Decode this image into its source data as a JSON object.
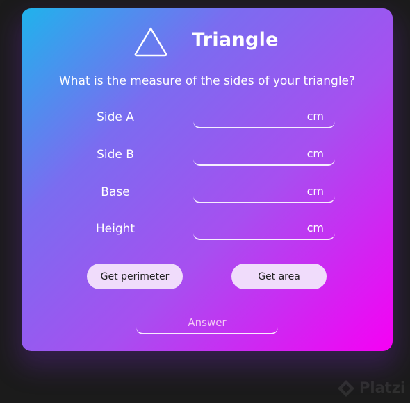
{
  "card": {
    "title": "Triangle",
    "title_icon": "triangle-outline-icon",
    "question": "What is the measure of the sides of your triangle?"
  },
  "fields": [
    {
      "label": "Side A",
      "unit": "cm",
      "value": ""
    },
    {
      "label": "Side B",
      "unit": "cm",
      "value": ""
    },
    {
      "label": "Base",
      "unit": "cm",
      "value": ""
    },
    {
      "label": "Height",
      "unit": "cm",
      "value": ""
    }
  ],
  "buttons": {
    "perimeter_label": "Get perimeter",
    "area_label": "Get area"
  },
  "answer": {
    "placeholder": "Answer"
  },
  "watermark": {
    "text": "Platzi",
    "icon": "platzi-logo-icon"
  },
  "colors": {
    "background": "#1b1b1b",
    "gradient_start": "#1fb3ec",
    "gradient_end": "#f600f4",
    "button_bg": "#f0dcfb"
  }
}
